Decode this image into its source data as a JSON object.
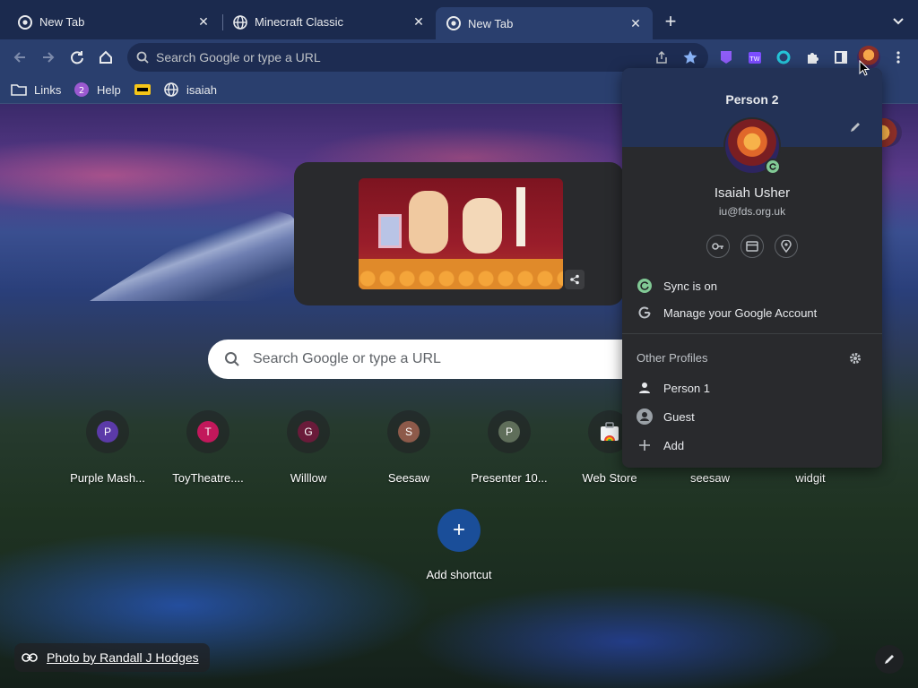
{
  "tabs": [
    {
      "title": "New Tab",
      "favicon": "chrome-icon",
      "active": false
    },
    {
      "title": "Minecraft Classic",
      "favicon": "globe-icon",
      "active": false
    },
    {
      "title": "New Tab",
      "favicon": "chrome-icon",
      "active": true
    }
  ],
  "toolbar": {
    "omnibox_placeholder": "Search Google or type a URL",
    "extensions": [
      "purple-extension-icon",
      "tw-extension-icon",
      "loop-extension-icon",
      "puzzle-icon"
    ]
  },
  "bookmarks": [
    {
      "label": "Links",
      "icon": "folder-icon"
    },
    {
      "label": "Help",
      "icon": "help-icon"
    },
    {
      "label": "",
      "icon": "imdb-icon"
    },
    {
      "label": "isaiah",
      "icon": "globe-icon"
    }
  ],
  "ntp": {
    "search_placeholder": "Search Google or type a URL",
    "shortcuts": [
      {
        "label": "Purple Mash...",
        "letter": "P",
        "color": "#5b3aa8"
      },
      {
        "label": "ToyTheatre....",
        "letter": "T",
        "color": "#c2185b"
      },
      {
        "label": "Willlow",
        "letter": "G",
        "color": "#6a1b3a"
      },
      {
        "label": "Seesaw",
        "letter": "S",
        "color": "#8d5a4a"
      },
      {
        "label": "Presenter 10...",
        "letter": "P",
        "color": "#5f6e5a"
      },
      {
        "label": "Web Store",
        "letter": "",
        "color": ""
      },
      {
        "label": "seesaw",
        "letter": "",
        "color": ""
      },
      {
        "label": "widgit",
        "letter": "",
        "color": ""
      }
    ],
    "add_shortcut_label": "Add shortcut",
    "attribution": "Photo by Randall J Hodges"
  },
  "profile_menu": {
    "profile_name": "Person 2",
    "full_name": "Isaiah Usher",
    "email": "iu@fds.org.uk",
    "sync_label": "Sync is on",
    "manage_label": "Manage your Google Account",
    "other_profiles_label": "Other Profiles",
    "other_profiles": [
      {
        "label": "Person 1",
        "icon": "person-icon"
      },
      {
        "label": "Guest",
        "icon": "guest-icon"
      },
      {
        "label": "Add",
        "icon": "plus-icon"
      }
    ]
  }
}
